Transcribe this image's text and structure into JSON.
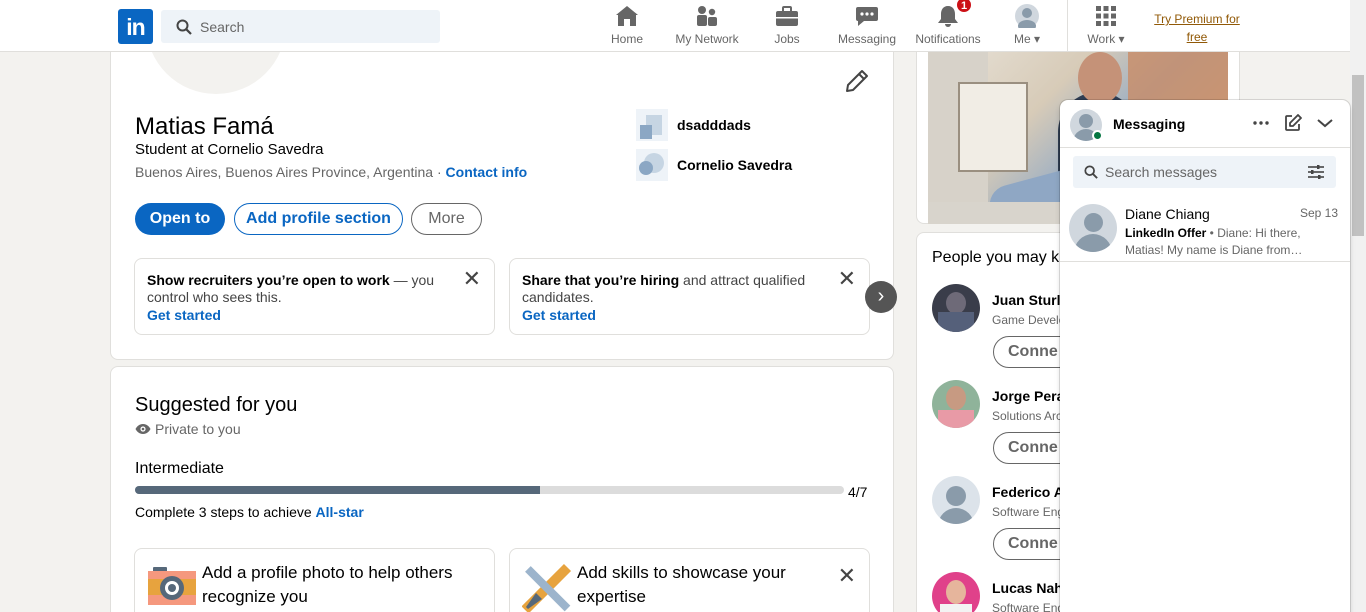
{
  "nav": {
    "logo": "in",
    "search_placeholder": "Search",
    "items": [
      {
        "label": "Home",
        "icon": "home-icon"
      },
      {
        "label": "My Network",
        "icon": "network-icon"
      },
      {
        "label": "Jobs",
        "icon": "briefcase-icon"
      },
      {
        "label": "Messaging",
        "icon": "messaging-icon"
      },
      {
        "label": "Notifications",
        "icon": "bell-icon",
        "badge": "1"
      },
      {
        "label": "Me",
        "icon": "avatar"
      },
      {
        "label": "Work",
        "icon": "grid-icon"
      }
    ],
    "premium": "Try Premium for free",
    "accent": "#0a66c2",
    "badge_color": "#cc1016"
  },
  "profile": {
    "name": "Matias Famá",
    "headline": "Student at Cornelio Savedra",
    "location": "Buenos Aires, Buenos Aires Province, Argentina",
    "separator": " · ",
    "contact_info": "Contact info",
    "experience": [
      {
        "label": "dsadddads"
      },
      {
        "label": "Cornelio Savedra"
      }
    ],
    "buttons": {
      "open_to": "Open to",
      "add_section": "Add profile section",
      "more": "More"
    },
    "promos": [
      {
        "bold": "Show recruiters you’re open to work",
        "rest": " — you control who sees this.",
        "cta": "Get started"
      },
      {
        "bold": "Share that you’re hiring",
        "rest": " and attract qualified candidates.",
        "cta": "Get started"
      }
    ]
  },
  "suggested": {
    "title": "Suggested for you",
    "privacy": "Private to you",
    "level": "Intermediate",
    "progress_done": 4,
    "progress_total": 7,
    "progress_text": "4/7",
    "steps_prefix": "Complete 3 steps to achieve ",
    "steps_link": "All-star",
    "tasks": [
      {
        "text": "Add a profile photo to help others recognize you"
      },
      {
        "text": "Add skills to showcase your expertise"
      }
    ]
  },
  "pymk": {
    "title": "People you may k",
    "people": [
      {
        "name": "Juan Sturla",
        "title": "Game Develo",
        "action": "Conne"
      },
      {
        "name": "Jorge Peral",
        "title": "Solutions Arc",
        "action": "Conne"
      },
      {
        "name": "Federico A",
        "title": "Software Eng",
        "action": "Conne"
      },
      {
        "name": "Lucas Nahu",
        "title": "Software Eng",
        "action": "Conne"
      }
    ]
  },
  "messaging": {
    "title": "Messaging",
    "search_placeholder": "Search messages",
    "conversations": [
      {
        "name": "Diane Chiang",
        "date": "Sep 13",
        "tag": "LinkedIn Offer",
        "bullet": " • ",
        "preview": " Diane: Hi there, Matias! My name is Diane from…"
      }
    ]
  }
}
